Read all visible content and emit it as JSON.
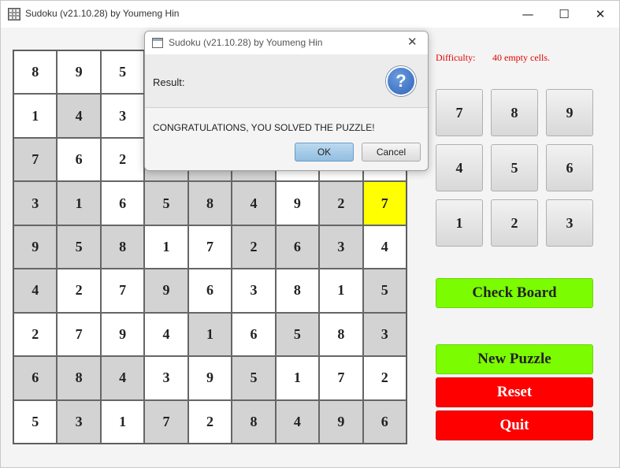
{
  "window": {
    "title": "Sudoku (v21.10.28) by Youmeng Hin",
    "minimize_glyph": "—",
    "maximize_glyph": "☐",
    "close_glyph": "✕"
  },
  "board": {
    "cells": [
      [
        "8",
        "9",
        "5",
        "",
        "",
        "",
        "",
        "",
        ""
      ],
      [
        "1",
        "4",
        "3",
        "",
        "",
        "",
        "",
        "",
        ""
      ],
      [
        "7",
        "6",
        "2",
        "",
        "",
        "",
        "",
        "",
        ""
      ],
      [
        "3",
        "1",
        "6",
        "5",
        "8",
        "4",
        "9",
        "2",
        "7"
      ],
      [
        "9",
        "5",
        "8",
        "1",
        "7",
        "2",
        "6",
        "3",
        "4"
      ],
      [
        "4",
        "2",
        "7",
        "9",
        "6",
        "3",
        "8",
        "1",
        "5"
      ],
      [
        "2",
        "7",
        "9",
        "4",
        "1",
        "6",
        "5",
        "8",
        "3"
      ],
      [
        "6",
        "8",
        "4",
        "3",
        "9",
        "5",
        "1",
        "7",
        "2"
      ],
      [
        "5",
        "3",
        "1",
        "7",
        "2",
        "8",
        "4",
        "9",
        "6"
      ]
    ],
    "shading": [
      [
        "w",
        "w",
        "w",
        "g",
        "g",
        "g",
        "w",
        "w",
        "w"
      ],
      [
        "w",
        "g",
        "w",
        "g",
        "g",
        "g",
        "w",
        "w",
        "w"
      ],
      [
        "g",
        "w",
        "w",
        "g",
        "g",
        "g",
        "w",
        "w",
        "w"
      ],
      [
        "g",
        "g",
        "w",
        "g",
        "g",
        "g",
        "w",
        "g",
        "y"
      ],
      [
        "g",
        "g",
        "g",
        "w",
        "w",
        "g",
        "g",
        "g",
        "w"
      ],
      [
        "g",
        "w",
        "w",
        "g",
        "w",
        "w",
        "w",
        "w",
        "g"
      ],
      [
        "w",
        "w",
        "w",
        "w",
        "g",
        "w",
        "g",
        "w",
        "g"
      ],
      [
        "g",
        "g",
        "g",
        "w",
        "w",
        "g",
        "w",
        "w",
        "w"
      ],
      [
        "w",
        "g",
        "w",
        "g",
        "w",
        "g",
        "g",
        "g",
        "g"
      ]
    ],
    "colors": {
      "given": "#d3d3d3",
      "empty": "#ffffff",
      "selected": "#ffff00"
    }
  },
  "difficulty": {
    "label": "Difficulty:",
    "value": "40 empty cells.",
    "color": "#e00000"
  },
  "numpad": [
    "7",
    "8",
    "9",
    "4",
    "5",
    "6",
    "1",
    "2",
    "3"
  ],
  "buttons": {
    "check_board": "Check Board",
    "new_puzzle": "New Puzzle",
    "reset": "Reset",
    "quit": "Quit",
    "green": "#7cfc00",
    "red": "#ff0000"
  },
  "dialog": {
    "title": "Sudoku (v21.10.28) by Youmeng Hin",
    "close_glyph": "✕",
    "header": "Result:",
    "icon_glyph": "?",
    "message": "CONGRATULATIONS, YOU SOLVED THE PUZZLE!",
    "ok_label": "OK",
    "cancel_label": "Cancel"
  }
}
